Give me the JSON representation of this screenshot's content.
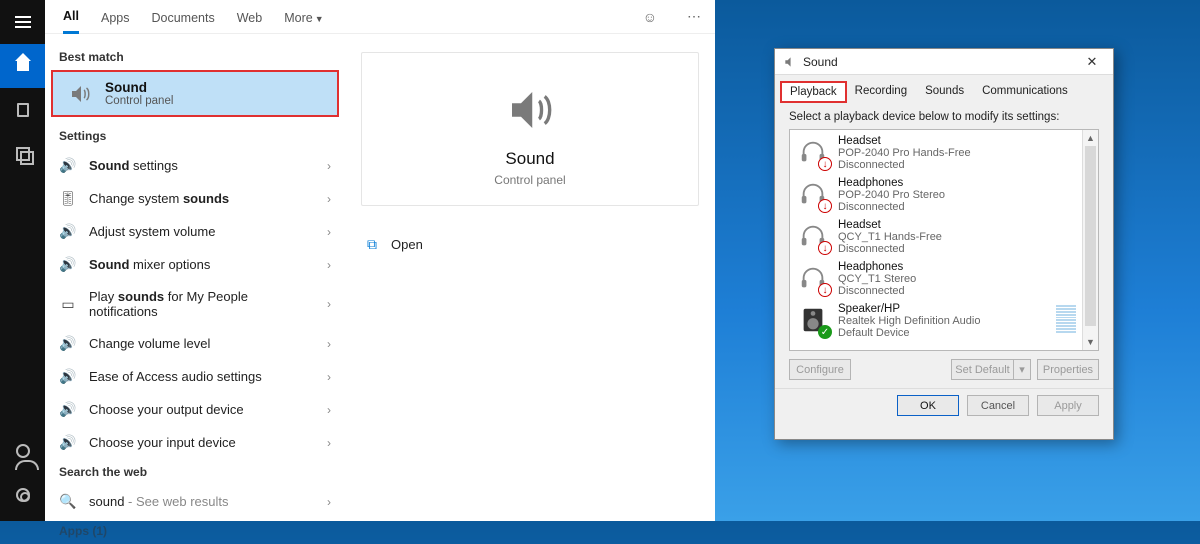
{
  "strip": {
    "icons_top": [
      "hamburger",
      "home",
      "document",
      "overlap"
    ],
    "icons_bottom": [
      "user",
      "gear"
    ]
  },
  "search": {
    "tabs": [
      "All",
      "Apps",
      "Documents",
      "Web",
      "More"
    ],
    "active_tab": 0,
    "best_match_header": "Best match",
    "best_match": {
      "title": "Sound",
      "subtitle": "Control panel"
    },
    "settings_header": "Settings",
    "settings": [
      {
        "icon": "🔊",
        "html": "<strong class='k'>Sound</strong> settings"
      },
      {
        "icon": "🎚",
        "html": "Change system <strong class='k'>sounds</strong>"
      },
      {
        "icon": "🔊",
        "html": "Adjust system volume"
      },
      {
        "icon": "🔊",
        "html": "<strong class='k'>Sound</strong> mixer options"
      },
      {
        "icon": "▭",
        "html": "Play <strong class='k'>sounds</strong> for My People notifications"
      },
      {
        "icon": "🔊",
        "html": "Change volume level"
      },
      {
        "icon": "🔊",
        "html": "Ease of Access audio settings"
      },
      {
        "icon": "🔊",
        "html": "Choose your output device"
      },
      {
        "icon": "🔊",
        "html": "Choose your input device"
      }
    ],
    "web_header": "Search the web",
    "web_query": "sound",
    "web_hint": "See web results",
    "apps_footer": "Apps (1)",
    "preview": {
      "title": "Sound",
      "subtitle": "Control panel",
      "action_open": "Open"
    }
  },
  "sound_dialog": {
    "title": "Sound",
    "tabs": [
      "Playback",
      "Recording",
      "Sounds",
      "Communications"
    ],
    "active_tab": 0,
    "instruction": "Select a playback device below to modify its settings:",
    "devices": [
      {
        "name": "Headset",
        "sub": "POP-2040 Pro Hands-Free",
        "status": "Disconnected",
        "badge": "red",
        "icon": "headset"
      },
      {
        "name": "Headphones",
        "sub": "POP-2040 Pro Stereo",
        "status": "Disconnected",
        "badge": "red",
        "icon": "headset"
      },
      {
        "name": "Headset",
        "sub": "QCY_T1 Hands-Free",
        "status": "Disconnected",
        "badge": "red",
        "icon": "headset"
      },
      {
        "name": "Headphones",
        "sub": "QCY_T1 Stereo",
        "status": "Disconnected",
        "badge": "red",
        "icon": "headset"
      },
      {
        "name": "Speaker/HP",
        "sub": "Realtek High Definition Audio",
        "status": "Default Device",
        "badge": "green",
        "icon": "speaker",
        "levels": true
      }
    ],
    "buttons": {
      "configure": "Configure",
      "set_default": "Set Default",
      "properties": "Properties",
      "ok": "OK",
      "cancel": "Cancel",
      "apply": "Apply"
    }
  }
}
